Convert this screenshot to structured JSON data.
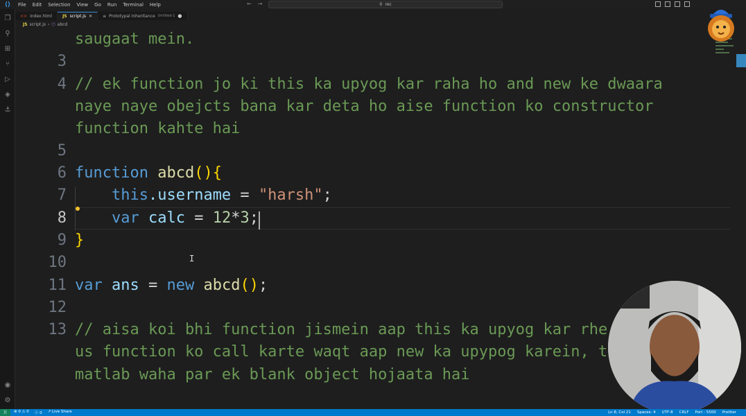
{
  "menu": [
    "File",
    "Edit",
    "Selection",
    "View",
    "Go",
    "Run",
    "Terminal",
    "Help"
  ],
  "search": {
    "text": "rec"
  },
  "tabs": [
    {
      "label": "index.html",
      "kind": "html"
    },
    {
      "label": "script.js",
      "kind": "js",
      "active": true
    },
    {
      "label": "Prototypal Inheritance",
      "sub": "Untitled-1"
    }
  ],
  "breadcrumb": {
    "file": "script.js",
    "symbol": "abcd"
  },
  "editor": {
    "wrapped_top": "saugaat mein.",
    "line_numbers": [
      "3",
      "4",
      "5",
      "6",
      "7",
      "8",
      "9",
      "10",
      "11",
      "12",
      "13"
    ],
    "line4_a": "// ek function jo ki this ka upyog kar raha ho and new ke dwaara",
    "line4_b": "naye naye obejcts bana kar deta ho aise function ko constructor",
    "line4_c": "function kahte hai",
    "l6_kw": "function",
    "l6_name": "abcd",
    "l6_paren": "()",
    "l6_brace": "{",
    "l7_this": "this",
    "l7_prop": ".username",
    "l7_eq": " = ",
    "l7_str": "\"harsh\"",
    "l7_semi": ";",
    "l8_kw": "var",
    "l8_var": "calc",
    "l8_eq": " = ",
    "l8_num1": "12",
    "l8_op": "*",
    "l8_num2": "3",
    "l8_semi": ";",
    "l9_brace": "}",
    "l11_kw": "var",
    "l11_var": "ans",
    "l11_eq": " = ",
    "l11_new": "new",
    "l11_fn": "abcd",
    "l11_paren": "()",
    "l11_semi": ";",
    "line13_a": "// aisa koi bhi function jismein aap this ka upyog kar rhe",
    "line13_b": "us function ko call karte waqt aap new ka upypog karein, t",
    "line13_c": "matlab waha par ek blank object hojaata hai"
  },
  "status": {
    "errors": "0",
    "warnings": "0",
    "info": "0",
    "live_share": "Live Share",
    "position": "Ln 8, Col 21",
    "spaces": "Spaces: 4",
    "encoding": "UTF-8",
    "eol": "CRLF",
    "port": "Port : 5500",
    "prettier": "Prettier"
  }
}
